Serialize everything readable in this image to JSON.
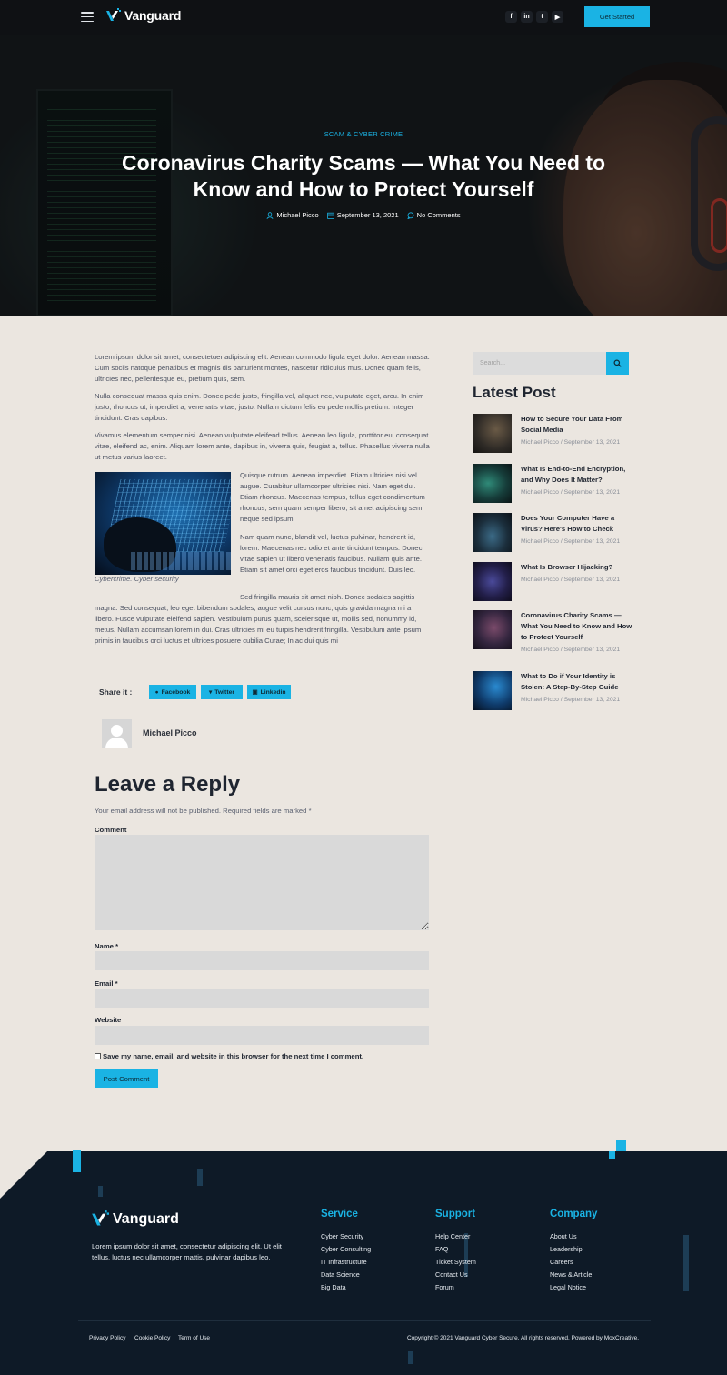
{
  "header": {
    "logo_text": "Vanguard",
    "socials": [
      {
        "icon": "facebook-icon",
        "glyph": "f"
      },
      {
        "icon": "linkedin-icon",
        "glyph": "in"
      },
      {
        "icon": "twitter-icon",
        "glyph": "t"
      },
      {
        "icon": "youtube-icon",
        "glyph": "▶"
      }
    ],
    "cta_label": "Get Started"
  },
  "hero": {
    "category": "SCAM & CYBER CRIME",
    "title": "Coronavirus Charity Scams — What You Need to Know and How to Protect Yourself",
    "author": "Michael Picco",
    "date": "September 13, 2021",
    "comments": "No Comments"
  },
  "article": {
    "p1": "Lorem ipsum dolor sit amet, consectetuer adipiscing elit. Aenean commodo ligula eget dolor. Aenean massa. Cum sociis natoque penatibus et magnis dis parturient montes, nascetur ridiculus mus. Donec quam felis, ultricies nec, pellentesque eu, pretium quis, sem.",
    "p2": "Nulla consequat massa quis enim. Donec pede justo, fringilla vel, aliquet nec, vulputate eget, arcu. In enim justo, rhoncus ut, imperdiet a, venenatis vitae, justo. Nullam dictum felis eu pede mollis pretium. Integer tincidunt. Cras dapibus.",
    "p3": "Vivamus elementum semper nisi. Aenean vulputate eleifend tellus. Aenean leo ligula, porttitor eu, consequat vitae, eleifend ac, enim. Aliquam lorem ante, dapibus in, viverra quis, feugiat a, tellus. Phasellus viverra nulla ut metus varius laoreet.",
    "p4": "Quisque rutrum. Aenean imperdiet. Etiam ultricies nisi vel augue. Curabitur ullamcorper ultricies nisi. Nam eget dui. Etiam rhoncus. Maecenas tempus, tellus eget condimentum rhoncus, sem quam semper libero, sit amet adipiscing sem neque sed ipsum.",
    "p5": "Nam quam nunc, blandit vel, luctus pulvinar, hendrerit id, lorem. Maecenas nec odio et ante tincidunt tempus. Donec vitae sapien ut libero venenatis faucibus. Nullam quis ante. Etiam sit amet orci eget eros faucibus tincidunt. Duis leo.",
    "p6a": "Sed fringilla mauris sit amet nibh. Donec sodales sagittis",
    "p6b": "magna. Sed consequat, leo eget bibendum sodales, augue velit cursus nunc, quis gravida magna mi a libero. Fusce vulputate eleifend sapien. Vestibulum purus quam, scelerisque ut, mollis sed, nonummy id, metus. Nullam accumsan lorem in dui. Cras ultricies mi eu turpis hendrerit fringilla. Vestibulum ante ipsum primis in faucibus orci luctus et ultrices posuere cubilia Curae; In ac dui quis mi",
    "caption": "Cybercrime. Cyber security"
  },
  "share": {
    "label": "Share it :",
    "facebook": "Facebook",
    "twitter": "Twitter",
    "linkedin": "Linkedin"
  },
  "author": {
    "name": "Michael Picco"
  },
  "reply": {
    "title": "Leave a Reply",
    "note": "Your email address will not be published. Required fields are marked *",
    "comment_label": "Comment",
    "name_label": "Name *",
    "email_label": "Email *",
    "website_label": "Website",
    "save_label": "Save my name, email, and website in this browser for the next time I comment.",
    "submit_label": "Post Comment"
  },
  "sidebar": {
    "search_placeholder": "Search...",
    "latest_title": "Latest Post",
    "posts": [
      {
        "title": "How to Secure Your Data From Social Media",
        "meta": "Michael Picco / September 13, 2021"
      },
      {
        "title": "What Is End-to-End Encryption, and Why Does It Matter?",
        "meta": "Michael Picco / September 13, 2021"
      },
      {
        "title": "Does Your Computer Have a Virus? Here's How to Check",
        "meta": "Michael Picco / September 13, 2021"
      },
      {
        "title": "What Is Browser Hijacking?",
        "meta": "Michael Picco / September 13, 2021"
      },
      {
        "title": "Coronavirus Charity Scams — What You Need to Know and How to Protect Yourself",
        "meta": "Michael Picco / September 13, 2021"
      },
      {
        "title": "What to Do if Your Identity is Stolen: A Step-By-Step Guide",
        "meta": "Michael Picco / September 13, 2021"
      }
    ]
  },
  "footer": {
    "logo_text": "Vanguard",
    "about": "Lorem ipsum dolor sit amet, consectetur adipiscing elit. Ut elit tellus, luctus nec ullamcorper mattis, pulvinar dapibus leo.",
    "service": {
      "title": "Service",
      "links": [
        "Cyber Security",
        "Cyber Consulting",
        "IT Infrastructure",
        "Data Science",
        "Big Data"
      ]
    },
    "support": {
      "title": "Support",
      "links": [
        "Help Center",
        "FAQ",
        "Ticket System",
        "Contact Us",
        "Forum"
      ]
    },
    "company": {
      "title": "Company",
      "links": [
        "About Us",
        "Leadership",
        "Careers",
        "News & Article",
        "Legal Notice"
      ]
    },
    "bottom_links": [
      "Privacy Policy",
      "Cookie Policy",
      "Term of Use"
    ],
    "copyright": "Copyright © 2021 Vanguard Cyber Secure, All rights reserved. Powered by MoxCreative."
  },
  "colors": {
    "accent": "#1ab3e4",
    "footer_bg": "#0e1a27",
    "page_bg": "#ebe6e0"
  }
}
